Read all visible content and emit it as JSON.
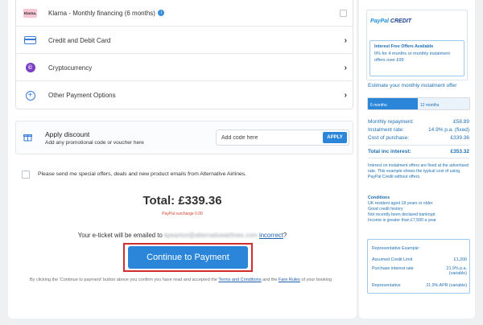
{
  "payment_options": [
    {
      "label": "Klarna - Monthly financing (6 months)",
      "logo_text": "Klarna."
    },
    {
      "label": "Credit and Debit Card"
    },
    {
      "label": "Cryptocurrency"
    },
    {
      "label": "Other Payment Options"
    }
  ],
  "discount": {
    "title": "Apply discount",
    "subtitle": "Add any promotional code or voucher here",
    "placeholder": "Add code here",
    "apply_label": "APPLY"
  },
  "newsletter_text": "Please send me special offers, deals and new product emails from Alternative Airlines.",
  "total": {
    "text": "Total: £339.36",
    "surcharge": "PayPal surcharge 0.00"
  },
  "eticket": {
    "prefix": "Your e-ticket will be emailed to",
    "email_masked": "kpearton@alternativeairlines.com",
    "link": "incorrect",
    "suffix": "?"
  },
  "pay_button": "Continue to Payment",
  "terms": {
    "prefix": "By clicking the 'Continue to payment' button above you confirm you have read and accepted the",
    "terms_link": "Terms and Conditions",
    "and": "and the",
    "fare_link": "Fare Rules",
    "suffix": "of your booking"
  },
  "sidebar": {
    "logo_paypal": "PayPal",
    "logo_credit": "CREDIT",
    "offers_title": "Interest Free Offers Available",
    "offers_text": "0% for 4 months or monthly instalment offers over £99",
    "estimate_title": "Estimate your monthly instalment offer",
    "tabs": [
      "6 months",
      "12 months"
    ],
    "monthly_label": "Monthly repayment:",
    "monthly_value": "£58.89",
    "rate_label": "Instalment rate:",
    "rate_value": "14.9% p.a. (fixed)",
    "cost_label": "Cost of purchase:",
    "cost_value": "£339.36",
    "interest_label": "Total inc interest:",
    "interest_value": "£353.32",
    "disclaimer": "Interest on instalment offers are fixed at the advertised rate. This example shows the typical cost of using PayPal Credit without offers.",
    "conditions_title": "Conditions",
    "conditions": [
      "UK resident aged 18 years or older",
      "Good credit history",
      "Not recently been declared bankrupt",
      "Income is greater than £7,500 a year"
    ],
    "rep_title": "Representative Example:",
    "rep_rows": [
      {
        "label": "Assumed Credit Limit",
        "value": "£1,200"
      },
      {
        "label": "Purchase interest rate",
        "value": "21.9% p.a. (variable)"
      },
      {
        "label": "Representative",
        "value": "21.9% APR (variable)"
      }
    ]
  },
  "colors": {
    "accent": "#2b86d9",
    "highlight_outline": "#d22d2d",
    "surcharge": "#d0432b",
    "paypal_navy": "#1c3f8c",
    "paypal_blue": "#1e6fb5"
  },
  "icons": [
    "klarna-logo",
    "credit-card-icon",
    "crypto-icon",
    "plus-circle-icon",
    "info-icon",
    "gift-icon",
    "chevron-right-icon"
  ]
}
